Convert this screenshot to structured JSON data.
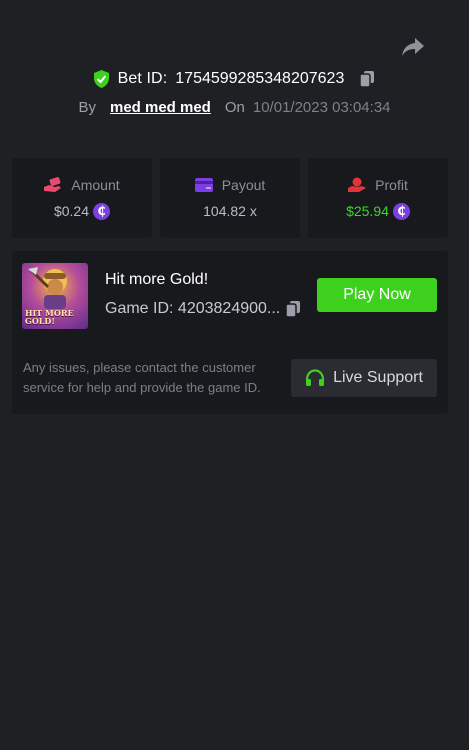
{
  "header": {
    "share_icon": "share-icon",
    "bet_label": "Bet ID:",
    "bet_id": "1754599285348207623",
    "by_label": "By",
    "username": "med med med",
    "on_label": "On",
    "date": "10/01/2023 03:04:34"
  },
  "stats": [
    {
      "label": "Amount",
      "icon": "hand-money-icon",
      "icon_color": "#e84a72",
      "value": "$0.24",
      "has_coin": true,
      "value_color": "#b8bcc4"
    },
    {
      "label": "Payout",
      "icon": "card-icon",
      "icon_color": "#7b3fe4",
      "value": "104.82 x",
      "has_coin": false,
      "value_color": "#b8bcc4"
    },
    {
      "label": "Profit",
      "icon": "profit-hand-icon",
      "icon_color": "#e0353b",
      "value": "$25.94",
      "has_coin": true,
      "value_color": "#3dd62a"
    }
  ],
  "coin_symbol": "₵",
  "game": {
    "thumbnail_text": "HIT MORE GOLD!",
    "title": "Hit more Gold!",
    "game_id_label": "Game ID:",
    "game_id": "4203824900...",
    "play_label": "Play Now"
  },
  "support": {
    "help_text": "Any issues, please contact the customer service for help and provide the game ID.",
    "button_label": "Live Support"
  },
  "colors": {
    "background": "#1f2024",
    "card": "#18191d",
    "accent_green": "#3dd11d",
    "shield_green": "#3dd11d"
  }
}
